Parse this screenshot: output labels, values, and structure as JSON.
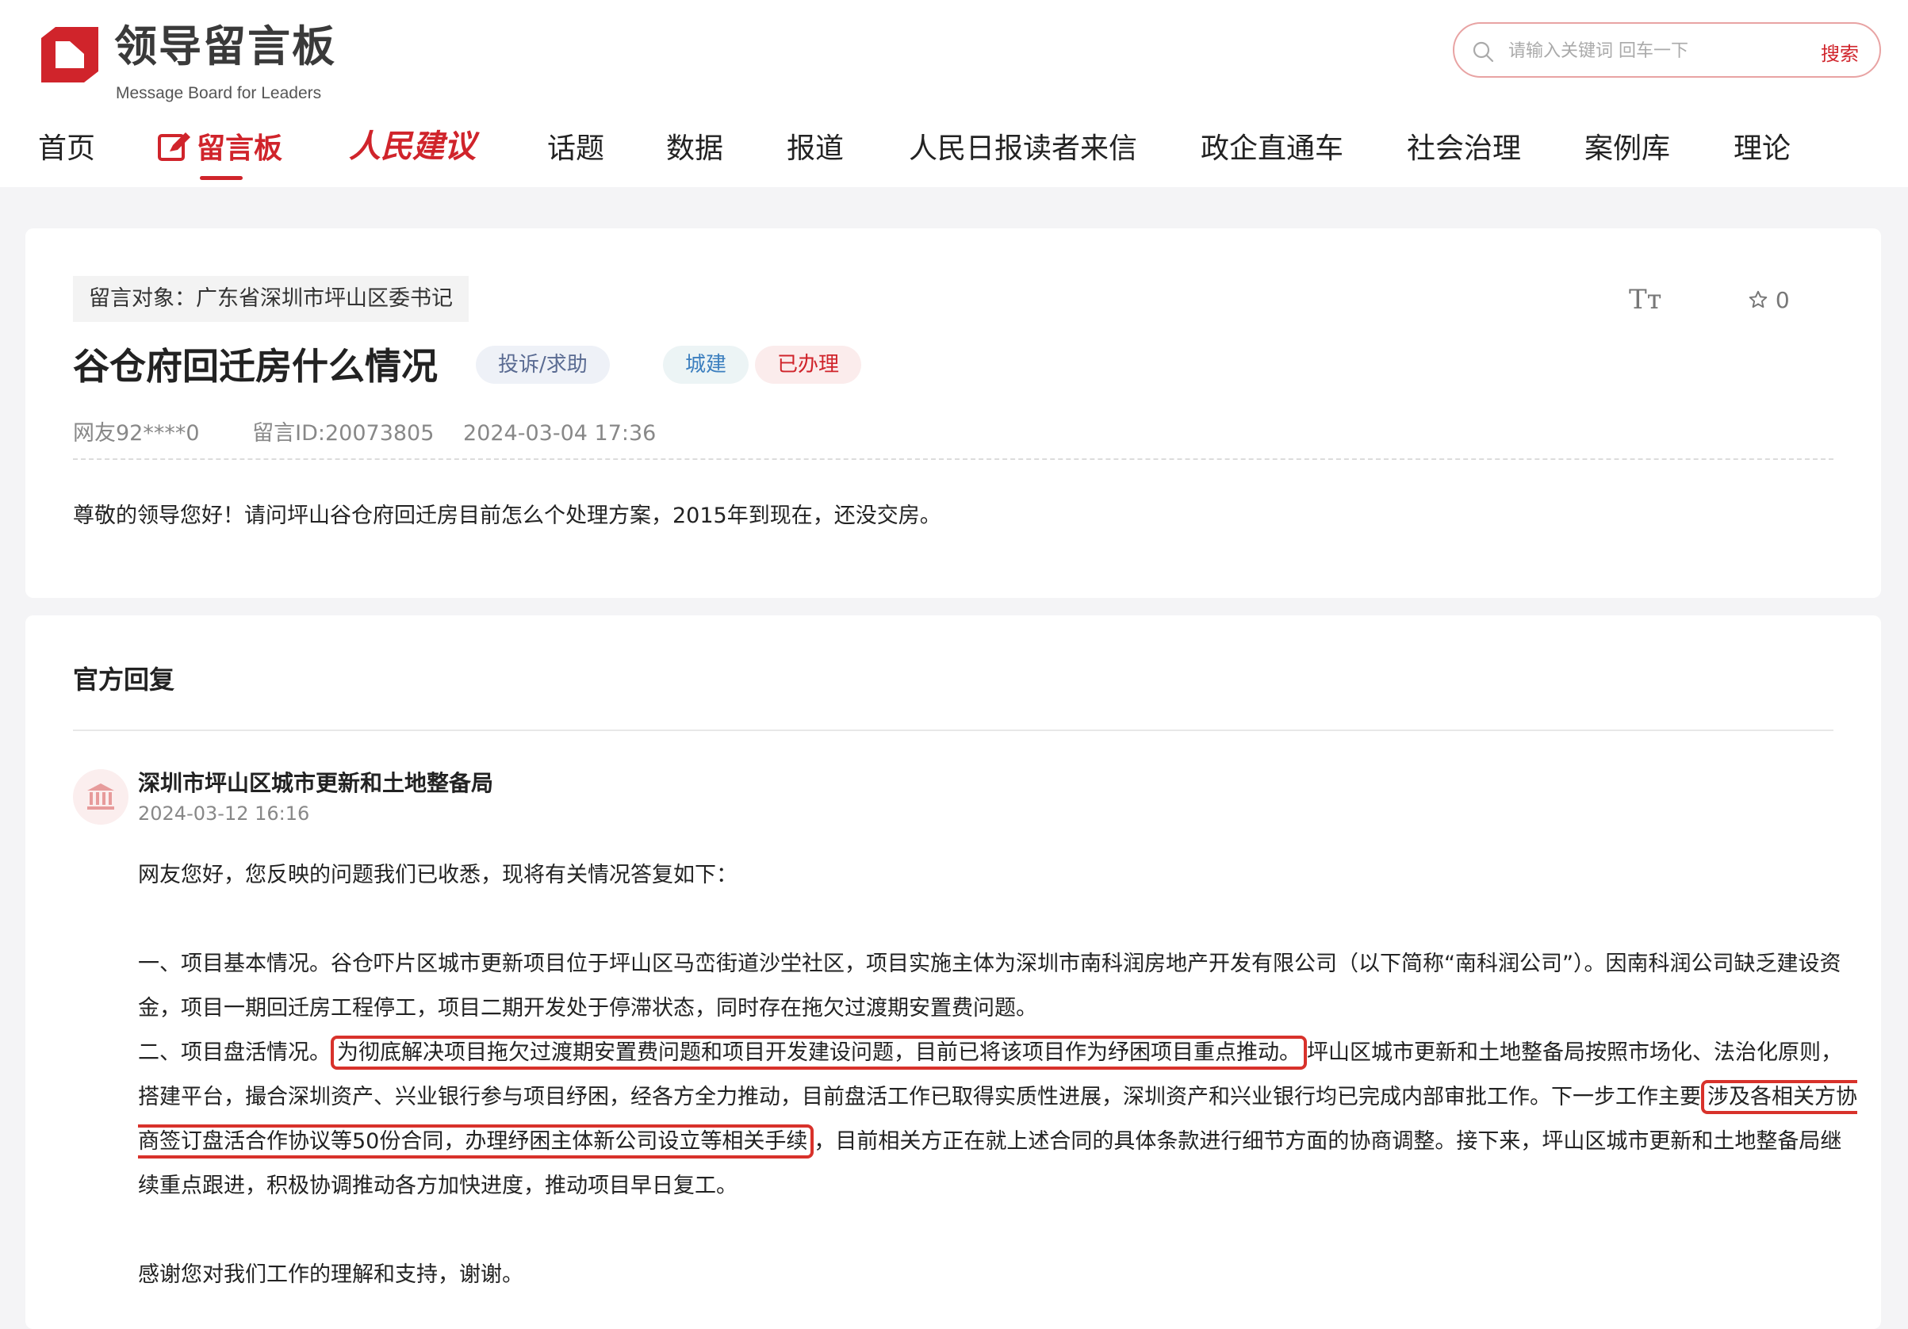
{
  "header": {
    "logo_title": "领导留言板",
    "logo_subtitle": "Message Board for Leaders",
    "search_placeholder": "请输入关键词 回车一下",
    "search_button": "搜索"
  },
  "nav": {
    "items": [
      "首页",
      "留言板",
      "人民建议",
      "话题",
      "数据",
      "报道",
      "人民日报读者来信",
      "政企直通车",
      "社会治理",
      "案例库",
      "理论"
    ],
    "active": "留言板"
  },
  "message": {
    "target": "留言对象：广东省深圳市坪山区委书记",
    "title": "谷仓府回迁房什么情况",
    "badges": [
      "投诉/求助",
      "城建",
      "已办理"
    ],
    "font_size_label": "Tт",
    "favorites": "0",
    "author": "网友92****0",
    "message_id": "留言ID:20073805",
    "date": "2024-03-04 17:36",
    "content": "尊敬的领导您好！请问坪山谷仓府回迁房目前怎么个处理方案，2015年到现在，还没交房。"
  },
  "reply": {
    "heading": "官方回复",
    "org": "深圳市坪山区城市更新和土地整备局",
    "date": "2024-03-12 16:16",
    "greeting": "网友您好，您反映的问题我们已收悉，现将有关情况答复如下：",
    "p1": "一、项目基本情况。谷仓吓片区城市更新项目位于坪山区马峦街道沙坣社区，项目实施主体为深圳市南科润房地产开发有限公司（以下简称“南科润公司”）。因南科润公司缺乏建设资金，项目一期回迁房工程停工，项目二期开发处于停滞状态，同时存在拖欠过渡期安置费问题。",
    "p2_lead": " 二、项目盘活情况。",
    "p2_hl1": "为彻底解决项目拖欠过渡期安置费问题和项目开发建设问题，目前已将该项目作为纾困项目重点推动。",
    "p2_mid": "坪山区城市更新和土地整备局按照市场化、法治化原则，搭建平台，撮合深圳资产、兴业银行参与项目纾困，经各方全力推动，目前盘活工作已取得实质性进展，深圳资产和兴业银行均已完成内部审批工作。下一步工作主要",
    "p2_hl2": "涉及各相关方协商签订盘活合作协议等50份合同，办理纾困主体新公司设立等相关手续",
    "p2_tail": "，目前相关方正在就上述合同的具体条款进行细节方面的协商调整。接下来，坪山区城市更新和土地整备局继续重点跟进，积极协调推动各方加快进度，推动项目早日复工。",
    "closing": "感谢您对我们工作的理解和支持，谢谢。"
  },
  "colors": {
    "brand_red": "#d0242b",
    "highlight_border": "#d8322b",
    "page_bg": "#f4f4f6"
  }
}
